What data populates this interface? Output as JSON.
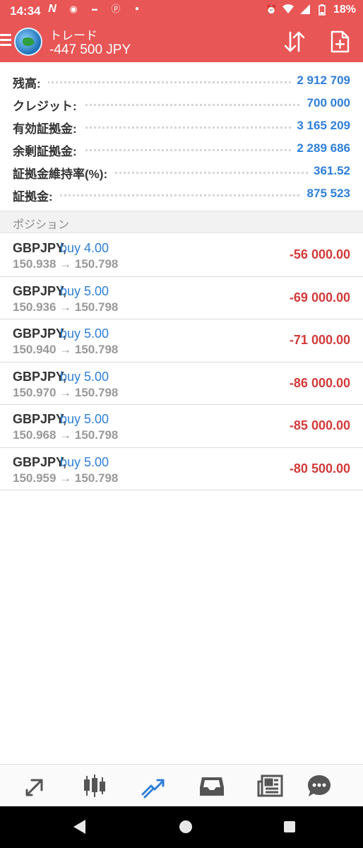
{
  "status_bar": {
    "time": "14:34",
    "battery": "18%"
  },
  "app_bar": {
    "title": "トレード",
    "profit": "-447 500 JPY"
  },
  "summary": [
    {
      "label": "残高:",
      "value": "2 912 709"
    },
    {
      "label": "クレジット:",
      "value": "700 000"
    },
    {
      "label": "有効証拠金:",
      "value": "3 165 209"
    },
    {
      "label": "余剰証拠金:",
      "value": "2 289 686"
    },
    {
      "label": "証拠金維持率(%):",
      "value": "361.52"
    },
    {
      "label": "証拠金:",
      "value": "875 523"
    }
  ],
  "positions_header": "ポジション",
  "positions": [
    {
      "symbol": "GBPJPY,",
      "type": "buy 4.00",
      "prices": "150.938 → 150.798",
      "profit": "-56 000.00"
    },
    {
      "symbol": "GBPJPY,",
      "type": "buy 5.00",
      "prices": "150.936 → 150.798",
      "profit": "-69 000.00"
    },
    {
      "symbol": "GBPJPY,",
      "type": "buy 5.00",
      "prices": "150.940 → 150.798",
      "profit": "-71 000.00"
    },
    {
      "symbol": "GBPJPY,",
      "type": "buy 5.00",
      "prices": "150.970 → 150.798",
      "profit": "-86 000.00"
    },
    {
      "symbol": "GBPJPY,",
      "type": "buy 5.00",
      "prices": "150.968 → 150.798",
      "profit": "-85 000.00"
    },
    {
      "symbol": "GBPJPY,",
      "type": "buy 5.00",
      "prices": "150.959 → 150.798",
      "profit": "-80 500.00"
    }
  ],
  "bottom_nav": [
    {
      "icon": "quotes-icon",
      "active": false
    },
    {
      "icon": "chart-candles-icon",
      "active": false
    },
    {
      "icon": "trade-icon",
      "active": true
    },
    {
      "icon": "history-inbox-icon",
      "active": false
    },
    {
      "icon": "news-icon",
      "active": false
    },
    {
      "icon": "messages-icon",
      "active": false
    }
  ],
  "colors": {
    "accent_red": "#e85656",
    "value_blue": "#2f7fd8",
    "loss_red": "#d33a3a",
    "active_nav": "#2f7fd8",
    "inactive_nav": "#555555"
  }
}
